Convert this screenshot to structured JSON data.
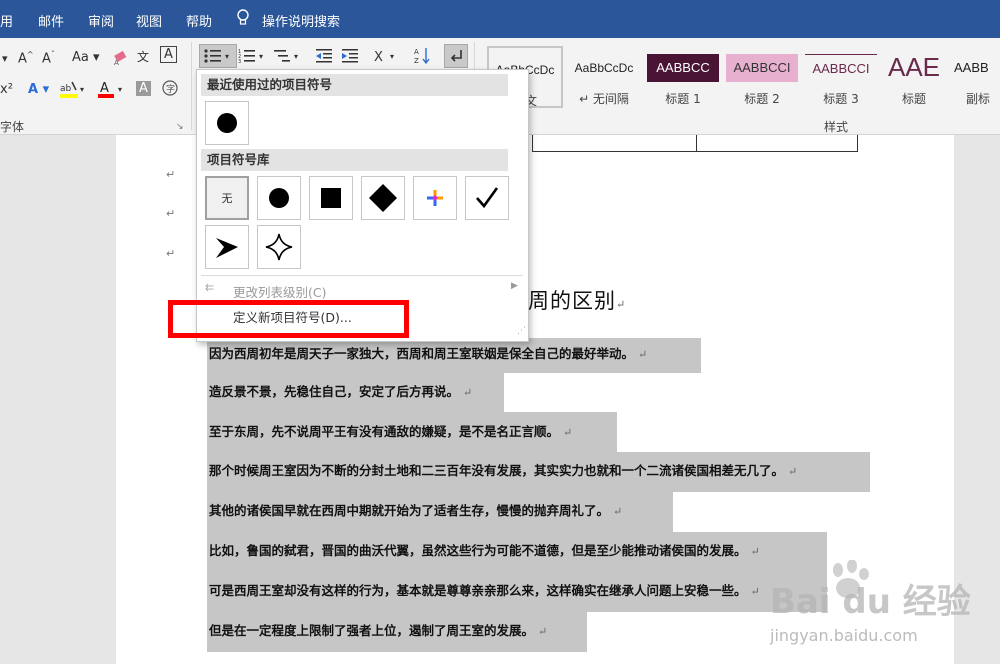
{
  "menubar": {
    "items": [
      "用",
      "邮件",
      "审阅",
      "视图",
      "帮助",
      "操作说明搜索"
    ],
    "bg": "#2b579a"
  },
  "ribbon": {
    "font_group_label": "字体",
    "styles_group_label": "样式",
    "font_buttons": [
      "A˄",
      "A˅",
      "Aa",
      "x²",
      "A",
      "A",
      "A"
    ],
    "styles": [
      {
        "preview": "AaBbCcDc",
        "name": "正文"
      },
      {
        "preview": "AaBbCcDc",
        "name": "↵ 无间隔"
      },
      {
        "preview": "AABBCC",
        "name": "标题 1"
      },
      {
        "preview": "AABBCCI",
        "name": "标题 2"
      },
      {
        "preview": "AABBCCI",
        "name": "标题 3"
      },
      {
        "preview": "AAE",
        "name": "标题"
      },
      {
        "preview": "AABB",
        "name": "副标"
      }
    ]
  },
  "dropdown": {
    "recent_header": "最近使用过的项目符号",
    "library_header": "项目符号库",
    "none_label": "无",
    "change_level": "更改列表级别(C)",
    "define_new": "定义新项目符号(D)...",
    "bullets_recent": [
      "filled-circle"
    ],
    "bullets_library": [
      "none",
      "filled-circle",
      "filled-square",
      "filled-diamond",
      "color-arrow",
      "checkmark",
      "arrowhead",
      "four-point-star"
    ]
  },
  "document": {
    "title": "X周的区别",
    "paragraphs": [
      "因为西周初年是周天子一家独大，西周和周王室联姻是保全自己的最好举动。",
      "造反景不景，先稳住自己，安定了后方再说。",
      "至于东周，先不说周平王有没有通敌的嫌疑，是不是名正言顺。",
      "那个时候周王室因为不断的分封土地和二三百年没有发展，其实实力也就和一个二流诸侯国相差无几了。",
      "其他的诸侯国早就在西周中期就开始为了适者生存，慢慢的抛弃周礼了。",
      "比如，鲁国的弑君，晋国的曲沃代翼，虽然这些行为可能不道德，但是至少能推动诸侯国的发展。",
      "可是西周王室却没有这样的行为，基本就是尊尊亲亲那么来，这样确实在继承人问题上安稳一些。",
      "但是在一定程度上限制了强者上位，遏制了周王室的发展。"
    ],
    "para_mark": "↵"
  },
  "watermark": {
    "brand": "Bai du 经验",
    "url": "jingyan.baidu.com"
  }
}
